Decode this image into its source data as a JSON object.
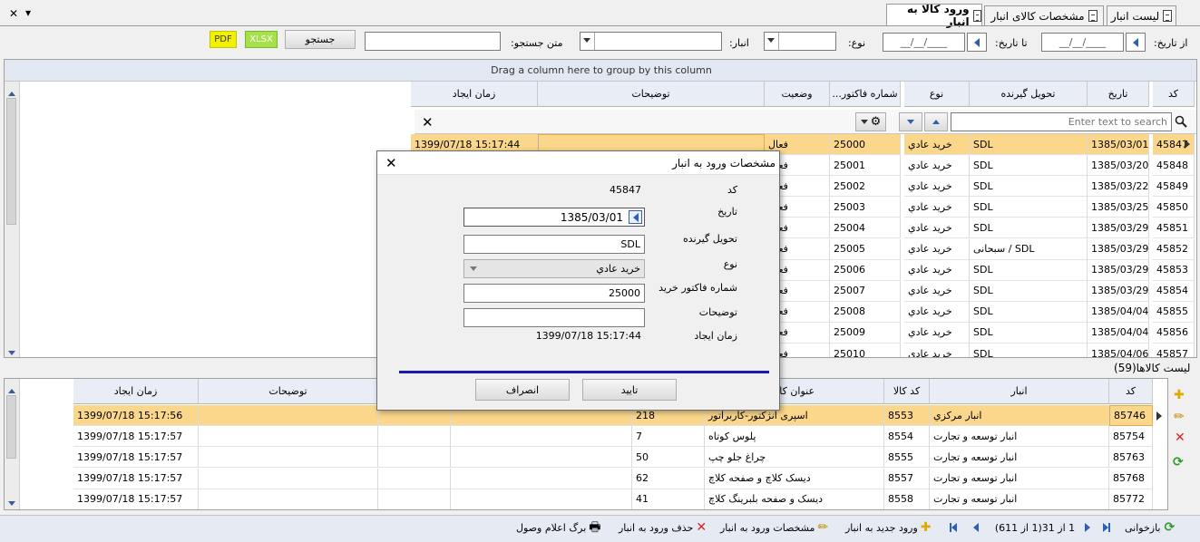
{
  "window": {
    "menu_arrow": "▾",
    "close_glyph": "✕"
  },
  "tabs": [
    {
      "label": "لیست انبار"
    },
    {
      "label": "مشخصات کالای انبار"
    },
    {
      "label": "ورود کالا به انبار"
    }
  ],
  "filter": {
    "from_date_label": "از تاریخ:",
    "to_date_label": "تا تاریخ:",
    "type_label": "نوع:",
    "warehouse_label": "انبار:",
    "search_text_label": "متن جستجو:",
    "search_button": "جستجو",
    "date_placeholder": "__/__/____",
    "xlsx": "XLSX",
    "pdf": "PDF"
  },
  "main_grid": {
    "group_hint": "Drag a column here to group by this column",
    "search_placeholder": "Enter text to search",
    "columns": [
      "کد",
      "تاریخ",
      "تحویل گیرنده",
      "نوع",
      "شماره فاکتور...",
      "وضعیت",
      "توضیحات",
      "زمان ایجاد"
    ],
    "rows": [
      [
        "45847",
        "1385/03/01",
        "SDL",
        "خرید عادي",
        "25000",
        "فعال",
        "",
        "1399/07/18 15:17:44"
      ],
      [
        "45848",
        "1385/03/20",
        "SDL",
        "خرید عادي",
        "25001",
        "فعال",
        "",
        ""
      ],
      [
        "45849",
        "1385/03/22",
        "SDL",
        "خرید عادي",
        "25002",
        "فعال",
        "",
        ""
      ],
      [
        "45850",
        "1385/03/25",
        "SDL",
        "خرید عادي",
        "25003",
        "فعال",
        "",
        ""
      ],
      [
        "45851",
        "1385/03/29",
        "SDL",
        "خرید عادي",
        "25004",
        "فعال",
        "",
        ""
      ],
      [
        "45852",
        "1385/03/29",
        "SDL / سبحانی",
        "خرید عادي",
        "25005",
        "فعال",
        "",
        ""
      ],
      [
        "45853",
        "1385/03/29",
        "SDL",
        "خرید عادي",
        "25006",
        "فعال",
        "",
        ""
      ],
      [
        "45854",
        "1385/03/29",
        "SDL",
        "خرید عادي",
        "25007",
        "فعال",
        "",
        ""
      ],
      [
        "45855",
        "1385/04/04",
        "SDL",
        "خرید عادي",
        "25008",
        "فعال",
        "",
        ""
      ],
      [
        "45856",
        "1385/04/04",
        "SDL",
        "خرید عادي",
        "25009",
        "فعال",
        "",
        ""
      ],
      [
        "45857",
        "1385/04/06",
        "SDL",
        "خرید عادي",
        "25010",
        "فعال",
        "",
        ""
      ]
    ]
  },
  "sub_grid": {
    "title": "لیست کالاها(59)",
    "columns": [
      "کد",
      "انبار",
      "کد کالا",
      "عنوان کالا",
      "",
      "",
      "",
      "توضیحات",
      "زمان ایجاد"
    ],
    "rows": [
      [
        "85746",
        "انبار مرکزي",
        "8553",
        "اسپری انژکتور-کاربراتور",
        "218",
        "",
        "",
        "",
        "1399/07/18 15:17:56"
      ],
      [
        "85754",
        "انبار توسعه و تجارت",
        "8554",
        "پلوس کوتاه",
        "7",
        "",
        "",
        "",
        "1399/07/18 15:17:57"
      ],
      [
        "85763",
        "انبار توسعه و تجارت",
        "8555",
        "چراغ جلو چپ",
        "50",
        "",
        "",
        "",
        "1399/07/18 15:17:57"
      ],
      [
        "85768",
        "انبار توسعه و تجارت",
        "8557",
        "دیسک کلاچ و صفحه کلاچ",
        "62",
        "",
        "",
        "",
        "1399/07/18 15:17:57"
      ],
      [
        "85772",
        "انبار توسعه و تجارت",
        "8558",
        "دیسک و صفحه بلبرینگ کلاچ",
        "41",
        "",
        "",
        "",
        "1399/07/18 15:17:57"
      ]
    ]
  },
  "dialog": {
    "title": "مشخصات ورود به انبار",
    "fields": {
      "code_label": "کد",
      "code_value": "45847",
      "date_label": "تاریخ",
      "date_value": "1385/03/01",
      "receiver_label": "تحویل گیرنده",
      "receiver_value": "SDL",
      "type_label": "نوع",
      "type_value": "خرید عادي",
      "invoice_label": "شماره فاکتور خرید",
      "invoice_value": "25000",
      "notes_label": "توضیحات",
      "notes_value": "",
      "created_label": "زمان ایجاد",
      "created_value": "1399/07/18 15:17:44"
    },
    "ok": "تایید",
    "cancel": "انصراف"
  },
  "bottom_bar": {
    "reload": "بازخوانی",
    "pager": "1 از 31(1 از 611)",
    "new_entry": "ورود جدید به انبار",
    "details": "مشخصات ورود به انبار",
    "delete": "حذف ورود به انبار",
    "receipt": "برگ اعلام وصول"
  },
  "colors": {
    "selected_row": "#fbd78b",
    "header_bg": "#e9eef6",
    "accent": "#2f5fb0",
    "progress": "#1b1bb3"
  }
}
